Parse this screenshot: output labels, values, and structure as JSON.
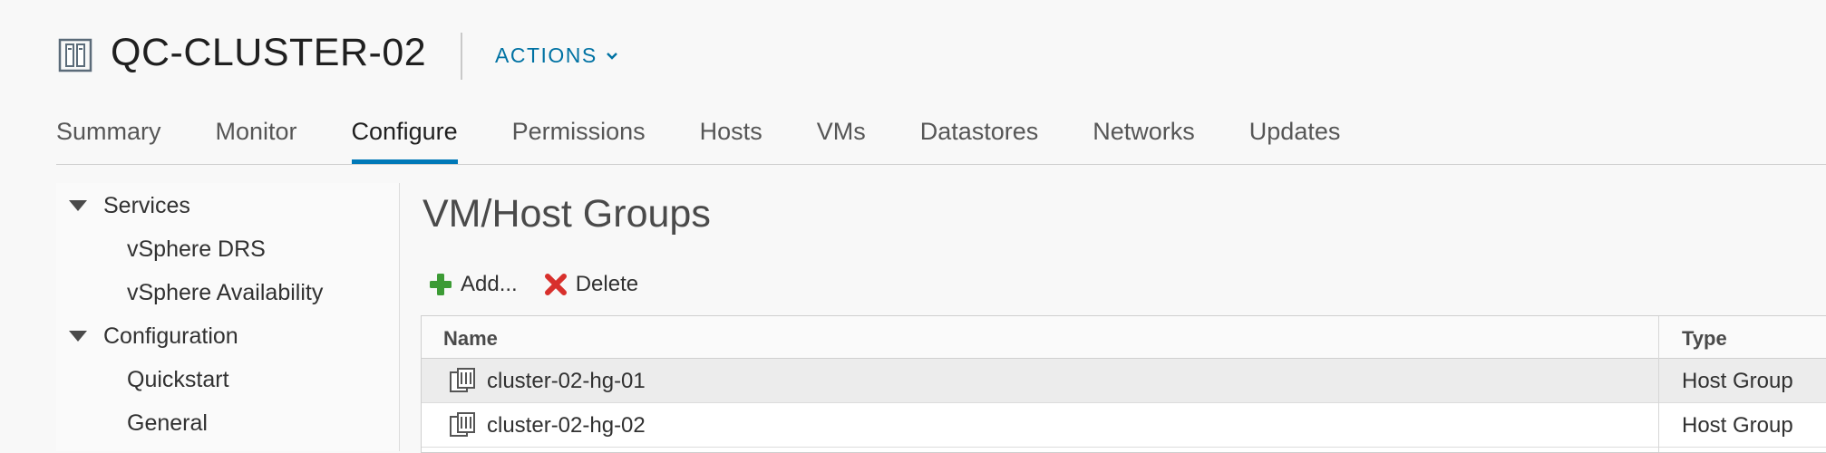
{
  "header": {
    "title": "QC-CLUSTER-02",
    "actions_label": "ACTIONS",
    "icon": "cluster-icon"
  },
  "tabs": [
    {
      "label": "Summary",
      "active": false
    },
    {
      "label": "Monitor",
      "active": false
    },
    {
      "label": "Configure",
      "active": true
    },
    {
      "label": "Permissions",
      "active": false
    },
    {
      "label": "Hosts",
      "active": false
    },
    {
      "label": "VMs",
      "active": false
    },
    {
      "label": "Datastores",
      "active": false
    },
    {
      "label": "Networks",
      "active": false
    },
    {
      "label": "Updates",
      "active": false
    }
  ],
  "tree": {
    "items": [
      {
        "label": "Services",
        "expandable": true
      },
      {
        "label": "vSphere DRS",
        "expandable": false
      },
      {
        "label": "vSphere Availability",
        "expandable": false
      },
      {
        "label": "Configuration",
        "expandable": true
      },
      {
        "label": "Quickstart",
        "expandable": false
      },
      {
        "label": "General",
        "expandable": false
      }
    ]
  },
  "panel": {
    "title": "VM/Host Groups",
    "toolbar": {
      "add_label": "Add...",
      "delete_label": "Delete"
    },
    "table": {
      "columns": [
        "Name",
        "Type"
      ],
      "rows": [
        {
          "name": "cluster-02-hg-01",
          "type": "Host Group",
          "selected": true
        },
        {
          "name": "cluster-02-hg-02",
          "type": "Host Group",
          "selected": false
        }
      ]
    }
  },
  "colors": {
    "accent": "#0079b8",
    "link": "#0072a3",
    "add_green": "#3c9b35",
    "delete_red": "#d8302c"
  }
}
